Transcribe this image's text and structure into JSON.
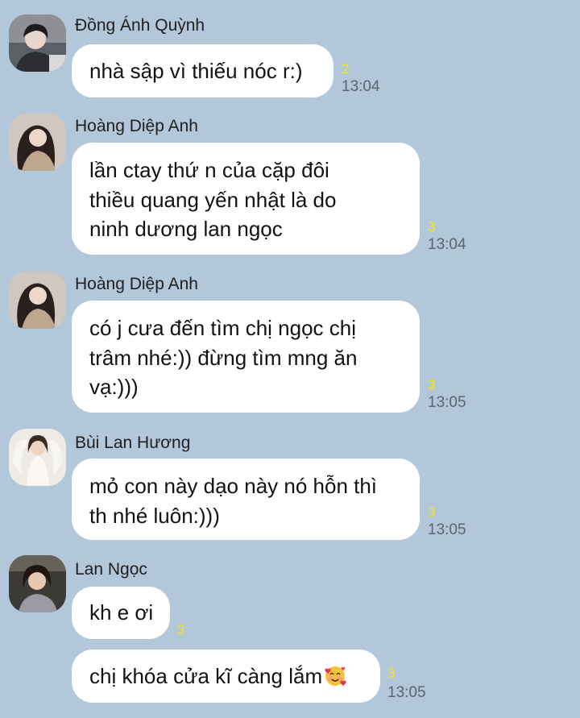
{
  "messages": [
    {
      "sender": "Đồng Ánh Quỳnh",
      "avatar": "avatar-dong-anh-quynh",
      "bubbles": [
        {
          "lines": [
            "nhà sập vì thiếu nóc r:)"
          ],
          "unread": "2",
          "time": "13:04"
        }
      ]
    },
    {
      "sender": "Hoàng Diệp Anh",
      "avatar": "avatar-hoang-diep-anh",
      "bubbles": [
        {
          "lines": [
            "lần ctay thứ n của cặp đôi",
            "thiều quang yến nhật là do",
            "ninh dương lan ngọc"
          ],
          "unread": "3",
          "time": "13:04"
        }
      ]
    },
    {
      "sender": "Hoàng Diệp Anh",
      "avatar": "avatar-hoang-diep-anh",
      "bubbles": [
        {
          "lines": [
            "có j cưa đến tìm chị ngọc chị",
            "trâm nhé:)) đừng tìm mng ăn",
            "vạ:)))"
          ],
          "unread": "3",
          "time": "13:05"
        }
      ]
    },
    {
      "sender": "Bùi Lan Hương",
      "avatar": "avatar-bui-lan-huong",
      "bubbles": [
        {
          "lines": [
            "mỏ con này dạo này nó hỗn thì",
            "th nhé luôn:)))"
          ],
          "unread": "3",
          "time": "13:05"
        }
      ]
    },
    {
      "sender": "Lan Ngọc",
      "avatar": "avatar-lan-ngoc",
      "bubbles": [
        {
          "lines": [
            "kh e ơi"
          ],
          "unread": "3",
          "time": ""
        },
        {
          "lines": [
            "chị khóa cửa kĩ càng lắm"
          ],
          "emoji": "smiling-face-with-hearts-emoji",
          "unread": "3",
          "time": "13:05"
        }
      ]
    }
  ],
  "colors": {
    "background": "#b2c7da",
    "bubble": "#ffffff",
    "unread": "#f5e21c",
    "time": "#5a6570"
  }
}
